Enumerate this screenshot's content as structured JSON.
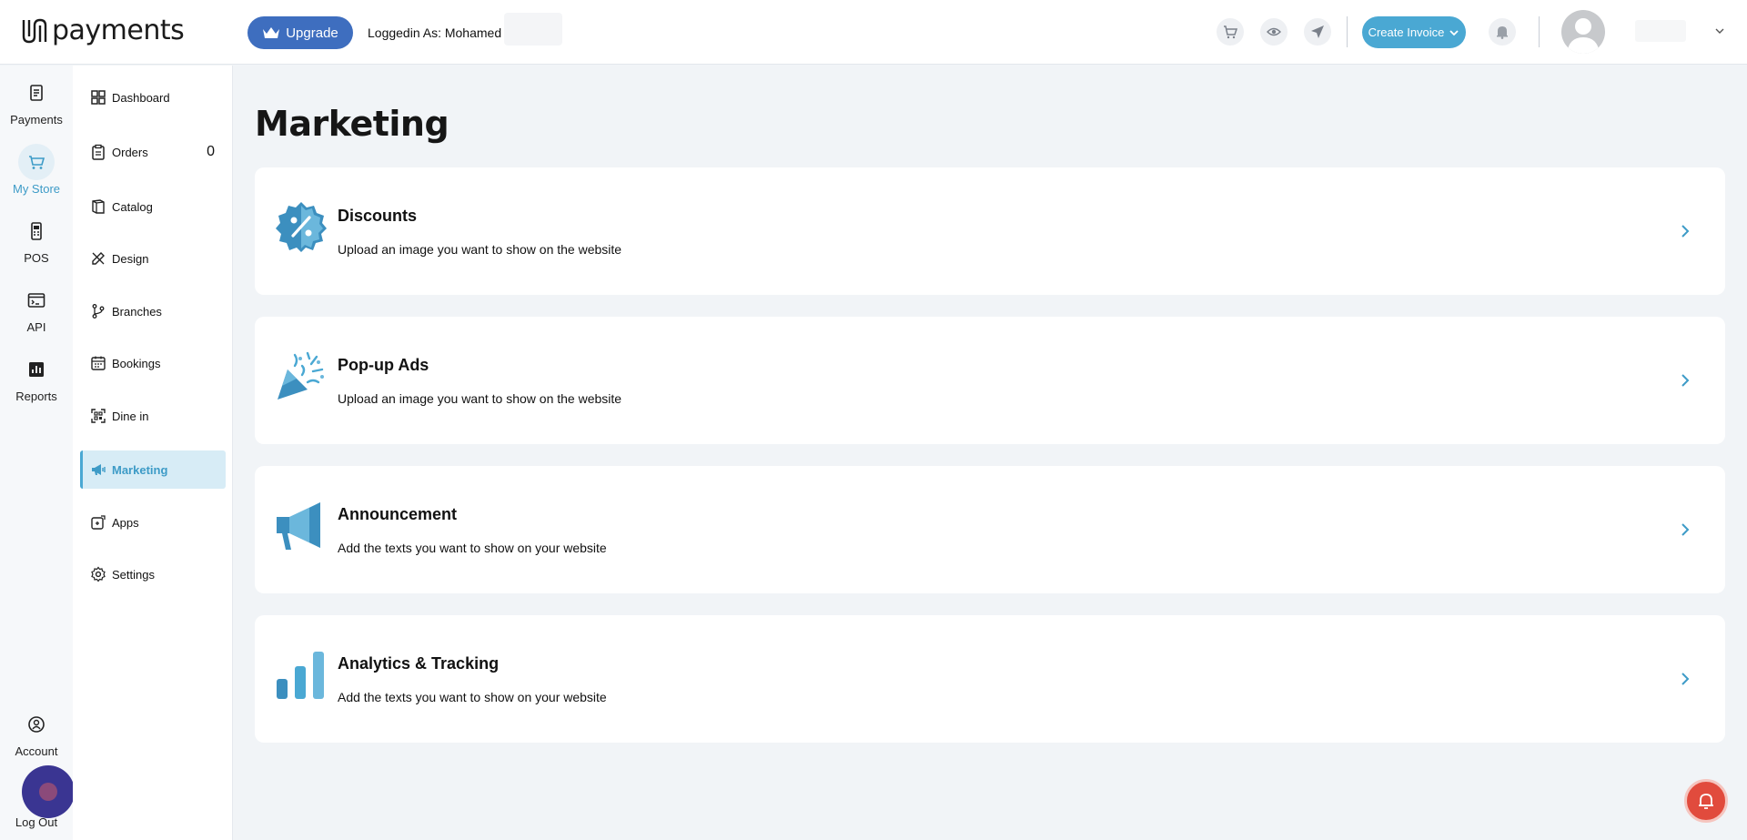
{
  "header": {
    "logo_text": "payments",
    "upgrade_label": "Upgrade",
    "logged_in_text": "Loggedin As: Mohamed S",
    "create_invoice_label": "Create Invoice",
    "icons": [
      "cart-icon",
      "eye-icon",
      "send-icon",
      "bell-icon"
    ]
  },
  "rail": {
    "items": [
      {
        "label": "Payments",
        "icon": "receipt-icon"
      },
      {
        "label": "My Store",
        "icon": "cart-icon",
        "active": true
      },
      {
        "label": "POS",
        "icon": "pos-terminal-icon"
      },
      {
        "label": "API",
        "icon": "terminal-icon"
      },
      {
        "label": "Reports",
        "icon": "bar-chart-icon"
      }
    ],
    "bottom": [
      {
        "label": "Account",
        "icon": "account-icon"
      },
      {
        "label": "Log Out",
        "icon": "logout-icon"
      }
    ]
  },
  "sidebar": {
    "items": [
      {
        "label": "Dashboard",
        "icon": "grid-icon"
      },
      {
        "label": "Orders",
        "icon": "clipboard-icon",
        "count": "0"
      },
      {
        "label": "Catalog",
        "icon": "book-icon"
      },
      {
        "label": "Design",
        "icon": "pencil-ruler-icon"
      },
      {
        "label": "Branches",
        "icon": "branch-icon"
      },
      {
        "label": "Bookings",
        "icon": "calendar-icon"
      },
      {
        "label": "Dine in",
        "icon": "qr-scan-icon"
      },
      {
        "label": "Marketing",
        "icon": "megaphone-icon",
        "active": true
      },
      {
        "label": "Apps",
        "icon": "apps-icon"
      },
      {
        "label": "Settings",
        "icon": "gear-icon"
      }
    ]
  },
  "main": {
    "title": "Marketing",
    "cards": [
      {
        "title": "Discounts",
        "description": "Upload an image you want to show on the website",
        "icon": "discount-badge-icon"
      },
      {
        "title": "Pop-up Ads",
        "description": "Upload an image you want to show on the website",
        "icon": "party-popper-icon"
      },
      {
        "title": "Announcement",
        "description": "Add the texts you want to show on your website",
        "icon": "megaphone-icon"
      },
      {
        "title": "Analytics & Tracking",
        "description": "Add the texts you want to show on your website",
        "icon": "analytics-bars-icon"
      }
    ]
  },
  "colors": {
    "accent": "#4aa8d3",
    "upgrade": "#3e6ebf",
    "background": "#f1f4f7",
    "notification": "#e14b3d",
    "chat": "#3a3592"
  }
}
